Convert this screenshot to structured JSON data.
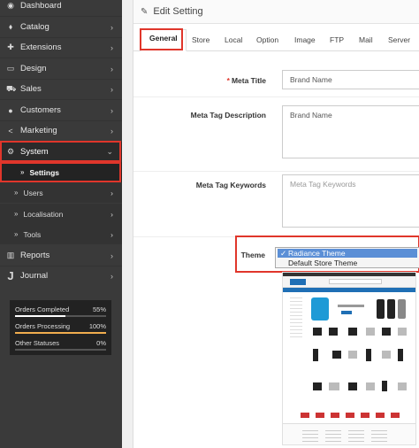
{
  "sidebar": {
    "items": [
      {
        "icon": "dashboard-icon",
        "label": "Dashboard",
        "has_chevron": false
      },
      {
        "icon": "tag-icon",
        "label": "Catalog",
        "has_chevron": true
      },
      {
        "icon": "puzzle-icon",
        "label": "Extensions",
        "has_chevron": true
      },
      {
        "icon": "monitor-icon",
        "label": "Design",
        "has_chevron": true
      },
      {
        "icon": "cart-icon",
        "label": "Sales",
        "has_chevron": true
      },
      {
        "icon": "user-icon",
        "label": "Customers",
        "has_chevron": true
      },
      {
        "icon": "share-icon",
        "label": "Marketing",
        "has_chevron": true
      }
    ],
    "system": {
      "icon": "cog-icon",
      "label": "System"
    },
    "system_children": [
      {
        "label": "Settings",
        "active": true
      },
      {
        "label": "Users"
      },
      {
        "label": "Localisation"
      },
      {
        "label": "Tools"
      }
    ],
    "bottom_items": [
      {
        "icon": "bar-chart-icon",
        "label": "Reports"
      },
      {
        "icon": "journal-j-icon",
        "label": "Journal",
        "glyph": "J"
      }
    ],
    "stats": [
      {
        "label": "Orders Completed",
        "value": "55%",
        "fraction": 0.55,
        "color": "#ffffff"
      },
      {
        "label": "Orders Processing",
        "value": "100%",
        "fraction": 1.0,
        "color": "#f0ad4e"
      },
      {
        "label": "Other Statuses",
        "value": "0%",
        "fraction": 0.0,
        "color": "#5bc0de"
      }
    ]
  },
  "main": {
    "title": "Edit Setting",
    "tabs": [
      "General",
      "Store",
      "Local",
      "Option",
      "Image",
      "FTP",
      "Mail",
      "Server"
    ],
    "active_tab": "General",
    "form": {
      "meta_title_label": "Meta Title",
      "meta_title_value": "Brand Name",
      "meta_desc_label": "Meta Tag Description",
      "meta_desc_value": "Brand Name",
      "meta_keywords_label": "Meta Tag Keywords",
      "meta_keywords_placeholder": "Meta Tag Keywords",
      "theme_label": "Theme",
      "theme_options": [
        "Radiance Theme",
        "Default Store Theme"
      ],
      "theme_selected": "Radiance Theme"
    }
  },
  "colors": {
    "highlight": "#e0362b",
    "sidebar_bg": "#3a3a3a",
    "select_blue": "#5b8fd6",
    "required": "#e0362b"
  }
}
